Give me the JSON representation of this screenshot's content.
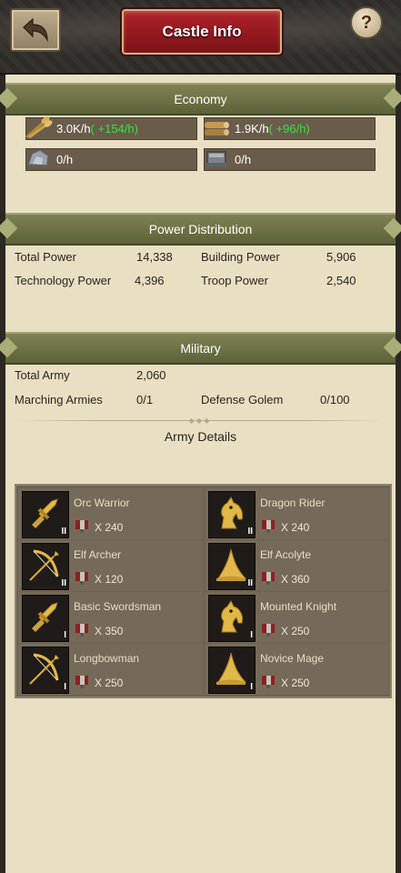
{
  "header": {
    "title": "Castle Info",
    "help_label": "?"
  },
  "economy": {
    "title": "Economy",
    "resources": [
      {
        "icon": "wheat-icon",
        "value": "3.0K/h",
        "rate": "( +154/h)"
      },
      {
        "icon": "lumber-icon",
        "value": "1.9K/h",
        "rate": "( +96/h)"
      },
      {
        "icon": "stone-icon",
        "value": "0/h",
        "rate": ""
      },
      {
        "icon": "iron-icon",
        "value": "0/h",
        "rate": ""
      }
    ]
  },
  "power": {
    "title": "Power Distribution",
    "total_power_label": "Total Power",
    "total_power_value": "14,338",
    "building_power_label": "Building Power",
    "building_power_value": "5,906",
    "technology_power_label": "Technology Power",
    "technology_power_value": "4,396",
    "troop_power_label": "Troop Power",
    "troop_power_value": "2,540"
  },
  "military": {
    "title": "Military",
    "total_army_label": "Total Army",
    "total_army_value": "2,060",
    "marching_label": "Marching Armies",
    "marching_value": "0/1",
    "golem_label": "Defense Golem",
    "golem_value": "0/100",
    "army_details_label": "Army Details"
  },
  "units": [
    {
      "name": "Orc Warrior",
      "count": "X 240",
      "tier": "II",
      "icon": "sword-icon"
    },
    {
      "name": "Dragon Rider",
      "count": "X 240",
      "tier": "II",
      "icon": "knight-horse-icon"
    },
    {
      "name": "Elf Archer",
      "count": "X 120",
      "tier": "II",
      "icon": "bow-icon"
    },
    {
      "name": "Elf Acolyte",
      "count": "X 360",
      "tier": "II",
      "icon": "mage-hat-icon"
    },
    {
      "name": "Basic Swordsman",
      "count": "X 350",
      "tier": "I",
      "icon": "sword-icon"
    },
    {
      "name": "Mounted Knight",
      "count": "X 250",
      "tier": "I",
      "icon": "knight-horse-icon"
    },
    {
      "name": "Longbowman",
      "count": "X 250",
      "tier": "I",
      "icon": "bow-icon"
    },
    {
      "name": "Novice Mage",
      "count": "X 250",
      "tier": "I",
      "icon": "mage-hat-icon"
    }
  ],
  "colors": {
    "accent_green": "#3ae046",
    "title_red": "#9a1b22",
    "band_olive": "#6b6f44",
    "parchment": "#e9dfc3"
  }
}
